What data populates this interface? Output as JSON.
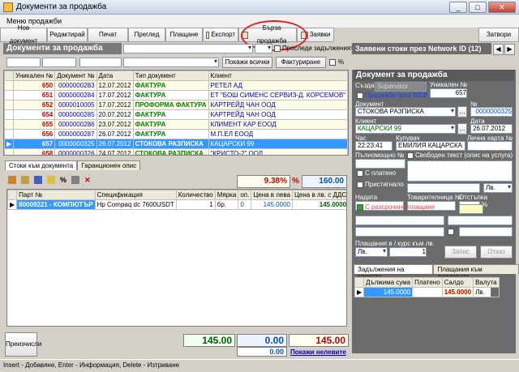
{
  "window": {
    "title": "Документи за продажба"
  },
  "menu": {
    "label": "Меню продажби"
  },
  "toolbar": {
    "new_doc": "Нов документ",
    "edit": "Редактирай",
    "print": "Печат",
    "preview": "Преглед",
    "payment": "Плащане",
    "export": "Експорт",
    "quick_sale": "Бърза продажба",
    "orders": "Заявки",
    "close": "Затвори"
  },
  "left_panel": {
    "title": "Документи за продажба",
    "pending_label": "Проследи задълженията"
  },
  "filters": {
    "show_all": "Покажи всички",
    "invoicing": "Фактуриране",
    "percent": "%"
  },
  "doc_table": {
    "headers": [
      "Уникален №",
      "Документ №",
      "Дата",
      "Тип документ",
      "Клиент"
    ],
    "rows": [
      {
        "num": "650",
        "doc": "0000000283",
        "date": "12.07.2012",
        "type": "ФАКТУРА",
        "client": "РЕТЕЛ АД"
      },
      {
        "num": "651",
        "doc": "0000000284",
        "date": "17.07.2012",
        "type": "ФАКТУРА",
        "client": "ЕТ \"БОШ СИМЕНС СЕРВИЗ-Д. КОРСЕМОВ\""
      },
      {
        "num": "652",
        "doc": "0000010005",
        "date": "17.07.2012",
        "type": "ПРОФОРМА ФАКТУРА",
        "client": "КАРТРЕЙД ЧАН ООД"
      },
      {
        "num": "654",
        "doc": "0000000285",
        "date": "20.07.2012",
        "type": "ФАКТУРА",
        "client": "КАРТРЕЙД ЧАН ООД"
      },
      {
        "num": "655",
        "doc": "0000000286",
        "date": "23.07.2012",
        "type": "ФАКТУРА",
        "client": "КЛИМЕНТ КАР ЕООД"
      },
      {
        "num": "656",
        "doc": "0000000287",
        "date": "26.07.2012",
        "type": "ФАКТУРА",
        "client": "М.П.ЕЛ ЕООД"
      },
      {
        "num": "657",
        "doc": "0000000325",
        "date": "26.07.2012",
        "type": "СТОКОВА РАЗПИСКА",
        "client": "КАЦАРСКИ 99"
      },
      {
        "num": "658",
        "doc": "0000000326",
        "date": "24.07.2012",
        "type": "СТОКОВА РАЗПИСКА",
        "client": "\"КРИСТО-2\" ООД"
      }
    ]
  },
  "network_title": "Заявени стоки през Network ID (12)",
  "item_tabs": {
    "goods": "Стоки към документа",
    "warranty": "Гаранционен опис"
  },
  "discount": {
    "percent": "9.38%",
    "sign": "%",
    "value": "160.00"
  },
  "item_table": {
    "headers": [
      "Парт №",
      "Спецификация",
      "Количество",
      "Мярка",
      "оп.",
      "Цена в лева",
      "Цена в лв. с ДДС",
      "Ст"
    ],
    "rows": [
      {
        "part": "80009221 - КОМПЮТЪР",
        "spec": "Hp Compaq dc 7600USDT",
        "qty": "1",
        "unit": "бр.",
        "op": "0",
        "price": "145.0000",
        "price_vat": "145.0000"
      }
    ]
  },
  "footer": {
    "recalc": "Преизчисли",
    "total1": "145.00",
    "total2": "0.00",
    "total3": "0.00",
    "total4": "145.00",
    "show_debts": "Покажи нелевите"
  },
  "status": "Insert - Добавяне, Enter - Информация, Delete - Изтриване",
  "doc_form": {
    "title": "Документ за продажба",
    "created_lbl": "Създал",
    "created": "Supervisor",
    "unique_lbl": "Уникален №",
    "unique": "657",
    "web_sale": "Продажба през WEB",
    "doc_lbl": "Документ",
    "doc": "СТОКОВА РАЗПИСКА",
    "no_lbl": "№",
    "no": "0000000325",
    "client_lbl": "Клиент",
    "client": "КАЦАРСКИ 99",
    "date_lbl": "Дата",
    "date": "26.07.2012",
    "hour_lbl": "Час",
    "hour": "22:23:41",
    "buyer_lbl": "Купувач",
    "buyer": "ЕМИЛИЯ КАЦАРСКА",
    "card_lbl": "Лична карта №",
    "proxy_lbl": "Пълномощно №",
    "free_text": "Свободен текст (опис на услуга)",
    "paid": "С платено",
    "prescribed": "Пристигнало",
    "currency": "Лв.",
    "due_lbl": "Надата",
    "goods_lbl": "Товарителница №",
    "discount_lbl": "Отстъпка",
    "pct": "%",
    "installment": "С разсрочено плащане",
    "payment_lbl": "Плащания в / курс към лв.",
    "pay_currency": "Лв.",
    "pay_rate": "1",
    "save": "Запис",
    "cancel": "Отказ"
  },
  "debts": {
    "tab1": "Задължения на клиента",
    "tab2": "Плащания към документа",
    "headers": [
      "Дължима сума",
      "Платено",
      "Салдо",
      "Валута"
    ],
    "row": {
      "due": "145.0000",
      "paid": "",
      "balance": "145.0000",
      "currency": "Лв."
    }
  }
}
